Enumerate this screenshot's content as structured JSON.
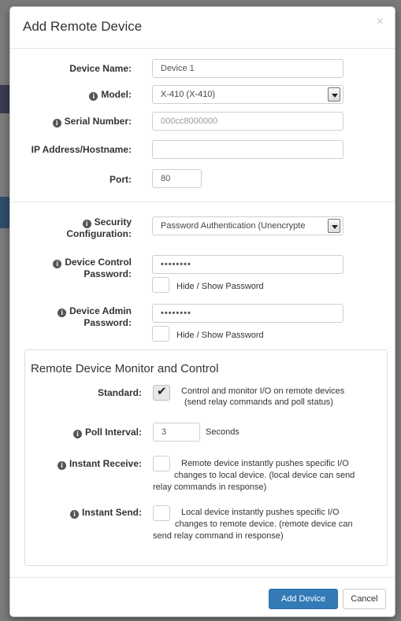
{
  "modal": {
    "title": "Add Remote Device",
    "close": "×"
  },
  "fields": {
    "device_name": {
      "label": "Device Name:",
      "value": "Device 1"
    },
    "model": {
      "label": "Model:",
      "value": "X-410 (X-410)"
    },
    "serial": {
      "label": "Serial Number:",
      "value": "000cc8000000"
    },
    "ip": {
      "label": "IP Address/Hostname:",
      "value": ""
    },
    "port": {
      "label": "Port:",
      "value": "80"
    },
    "security": {
      "label_line1": "Security",
      "label_line2": "Configuration:",
      "value": "Password Authentication (Unencrypte"
    },
    "control_password": {
      "label_line1": "Device Control",
      "label_line2": "Password:",
      "value": "••••••••",
      "toggle_label": "Hide / Show Password"
    },
    "admin_password": {
      "label_line1": "Device Admin",
      "label_line2": "Password:",
      "value": "••••••••",
      "toggle_label": "Hide / Show Password"
    }
  },
  "monitor": {
    "title": "Remote Device Monitor and Control",
    "standard": {
      "label": "Standard:",
      "checked": true,
      "desc_line1": "Control and monitor I/O on remote devices",
      "desc_line2": "(send relay commands and poll status)"
    },
    "poll": {
      "label": "Poll Interval:",
      "value": "3",
      "unit": "Seconds"
    },
    "instant_receive": {
      "label": "Instant Receive:",
      "checked": false,
      "desc_line1": "Remote device instantly pushes specific I/O",
      "desc_line2": "changes to local device. (local device can send",
      "desc_line3": "relay commands in response)"
    },
    "instant_send": {
      "label": "Instant Send:",
      "checked": false,
      "desc_line1": "Local device instantly pushes specific I/O",
      "desc_line2": "changes to remote device. (remote device can",
      "desc_line3": "send relay command in response)"
    }
  },
  "footer": {
    "add_label": "Add Device",
    "cancel_label": "Cancel"
  },
  "colors": {
    "primary": "#337ab7",
    "backdrop": "#7b7b7b"
  }
}
